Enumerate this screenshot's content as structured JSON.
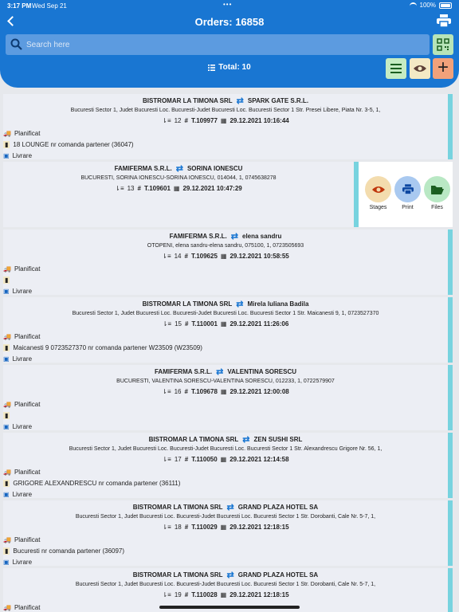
{
  "status": {
    "time": "3:17 PM",
    "date": "Wed Sep 21",
    "battery": "100%"
  },
  "header": {
    "title": "Orders: 16858",
    "search_placeholder": "Search here",
    "total": "Total: 10"
  },
  "colors": {
    "header": "#1976d2",
    "accent_border": "#77d3df",
    "truck": "#2e7d32"
  },
  "orders": [
    {
      "from": "BISTROMAR LA TIMONA SRL",
      "to": "SPARK GATE S.R.L.",
      "address": "Bucuresti Sector 1, Judet Bucuresti Loc. Bucuresti-Judet Bucuresti Loc. Bucuresti Sector 1 Str. Presei Libere, Piata Nr. 3-5, 1,",
      "count": "12",
      "number": "T.109977",
      "datetime": "29.12.2021 10:16:44",
      "status": "Planificat",
      "note": "18 LOUNGE  nr comanda partener  (36047)",
      "delivery": "Livrare"
    },
    {
      "from": "FAMIFERMA S.R.L.",
      "to": "SORINA IONESCU",
      "address": "BUCURESTI, SORINA IONESCU-SORINA IONESCU, 014044, 1, 0745638278",
      "count": "13",
      "number": "T.109601",
      "datetime": "29.12.2021 10:47:29",
      "status": "",
      "note": "",
      "delivery": ""
    },
    {
      "from": "FAMIFERMA S.R.L.",
      "to": "elena sandru",
      "address": "OTOPENI, elena sandru-elena sandru, 075100, 1, 0723505693",
      "count": "14",
      "number": "T.109625",
      "datetime": "29.12.2021 10:58:55",
      "status": "Planificat",
      "note": "",
      "delivery": "Livrare"
    },
    {
      "from": "BISTROMAR LA TIMONA SRL",
      "to": "Mirela Iuliana Badila",
      "address": "Bucuresti Sector 1, Judet Bucuresti Loc. Bucuresti-Judet Bucuresti Loc. Bucuresti Sector 1 Str. Maicanesti 9, 1, 0723527370",
      "count": "15",
      "number": "T.110001",
      "datetime": "29.12.2021 11:26:06",
      "status": "Planificat",
      "note": "Maicanesti 9 0723527370 nr comanda partener W23509 (W23509)",
      "delivery": "Livrare"
    },
    {
      "from": "FAMIFERMA S.R.L.",
      "to": "VALENTINA SORESCU",
      "address": "BUCURESTI, VALENTINA SORESCU-VALENTINA SORESCU, 012233, 1, 0722579907",
      "count": "16",
      "number": "T.109678",
      "datetime": "29.12.2021 12:00:08",
      "status": "Planificat",
      "note": "",
      "delivery": "Livrare"
    },
    {
      "from": "BISTROMAR LA TIMONA SRL",
      "to": "ZEN SUSHI SRL",
      "address": "Bucuresti Sector 1, Judet Bucuresti Loc. Bucuresti-Judet Bucuresti Loc. Bucuresti Sector 1 Str. Alexandrescu Grigore Nr. 56, 1,",
      "count": "17",
      "number": "T.110050",
      "datetime": "29.12.2021 12:14:58",
      "status": "Planificat",
      "note": "GRIGORE ALEXANDRESCU  nr comanda partener  (36111)",
      "delivery": "Livrare"
    },
    {
      "from": "BISTROMAR LA TIMONA SRL",
      "to": "GRAND PLAZA HOTEL SA",
      "address": "Bucuresti Sector 1, Judet Bucuresti Loc. Bucuresti-Judet Bucuresti Loc. Bucuresti Sector 1 Str. Dorobanti, Cale Nr. 5-7, 1,",
      "count": "18",
      "number": "T.110029",
      "datetime": "29.12.2021 12:18:15",
      "status": "Planificat",
      "note": "Bucuresti  nr comanda partener  (36097)",
      "delivery": "Livrare"
    },
    {
      "from": "BISTROMAR LA TIMONA SRL",
      "to": "GRAND PLAZA HOTEL SA",
      "address": "Bucuresti Sector 1, Judet Bucuresti Loc. Bucuresti-Judet Bucuresti Loc. Bucuresti Sector 1 Str. Dorobanti, Cale Nr. 5-7, 1,",
      "count": "19",
      "number": "T.110028",
      "datetime": "29.12.2021 12:18:15",
      "status": "Planificat",
      "note": "",
      "delivery": ""
    }
  ],
  "actions": {
    "stages": "Stages",
    "print": "Print",
    "files": "Files"
  }
}
